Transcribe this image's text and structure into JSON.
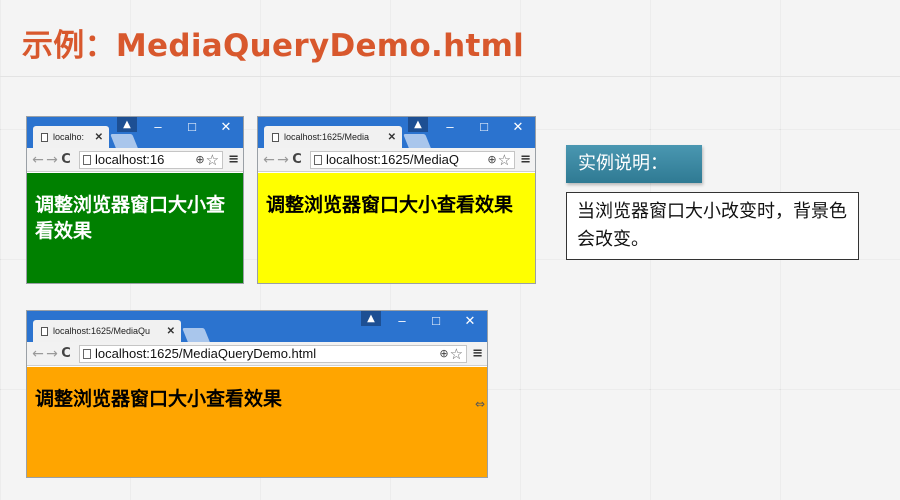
{
  "slide": {
    "title": "示例：MediaQueryDemo.html"
  },
  "browsers": [
    {
      "tab_title": "localho:",
      "url": "localhost:16",
      "content_text": "调整浏览器窗口大小查看效果",
      "bg_color": "#008000",
      "text_color": "#ffffff"
    },
    {
      "tab_title": "localhost:1625/Media",
      "url": "localhost:1625/MediaQ",
      "content_text": "调整浏览器窗口大小查看效果",
      "bg_color": "#ffff00",
      "text_color": "#000000"
    },
    {
      "tab_title": "localhost:1625/MediaQu",
      "url": "localhost:1625/MediaQueryDemo.html",
      "content_text": "调整浏览器窗口大小查看效果",
      "bg_color": "#ffa500",
      "text_color": "#000000"
    }
  ],
  "chrome": {
    "back": "←",
    "forward": "→",
    "reload": "C",
    "minimize": "–",
    "maximize": "□",
    "close": "✕",
    "tab_close": "✕",
    "profile": "▲",
    "zoom": "⊕",
    "star": "☆",
    "menu": "≡",
    "icons": [
      "page-icon",
      "back-arrow-icon",
      "forward-arrow-icon",
      "reload-icon",
      "zoom-icon",
      "star-icon",
      "menu-icon",
      "profile-icon"
    ]
  },
  "note": {
    "tag": "实例说明：",
    "text": "当浏览器窗口大小改变时，背景色会改变。"
  }
}
